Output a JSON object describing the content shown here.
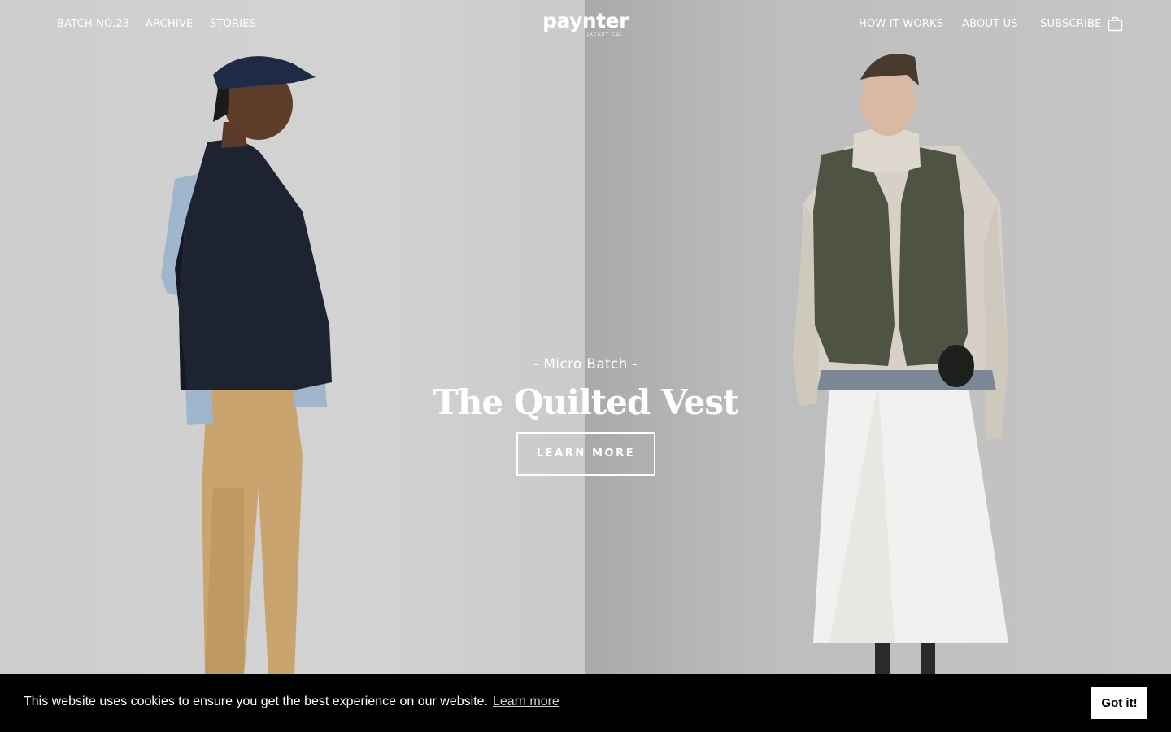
{
  "nav": {
    "left": [
      "BATCH NO.23",
      "ARCHIVE",
      "STORIES"
    ],
    "right": [
      "HOW IT WORKS",
      "ABOUT US",
      "SUBSCRIBE"
    ],
    "cart_icon": "shopping-bag-icon"
  },
  "logo": {
    "main": "paynter",
    "sub": "JACKET CO."
  },
  "hero": {
    "eyebrow": "- Micro Batch -",
    "title": "The Quilted Vest",
    "cta": "LEARN MORE"
  },
  "cookie": {
    "message": "This website uses cookies to ensure you get the best experience on our website.",
    "link": "Learn more",
    "button": "Got it!"
  },
  "colors": {
    "text": "#ffffff",
    "cookie_bar": "#000000",
    "button_bg": "#ffffff"
  }
}
